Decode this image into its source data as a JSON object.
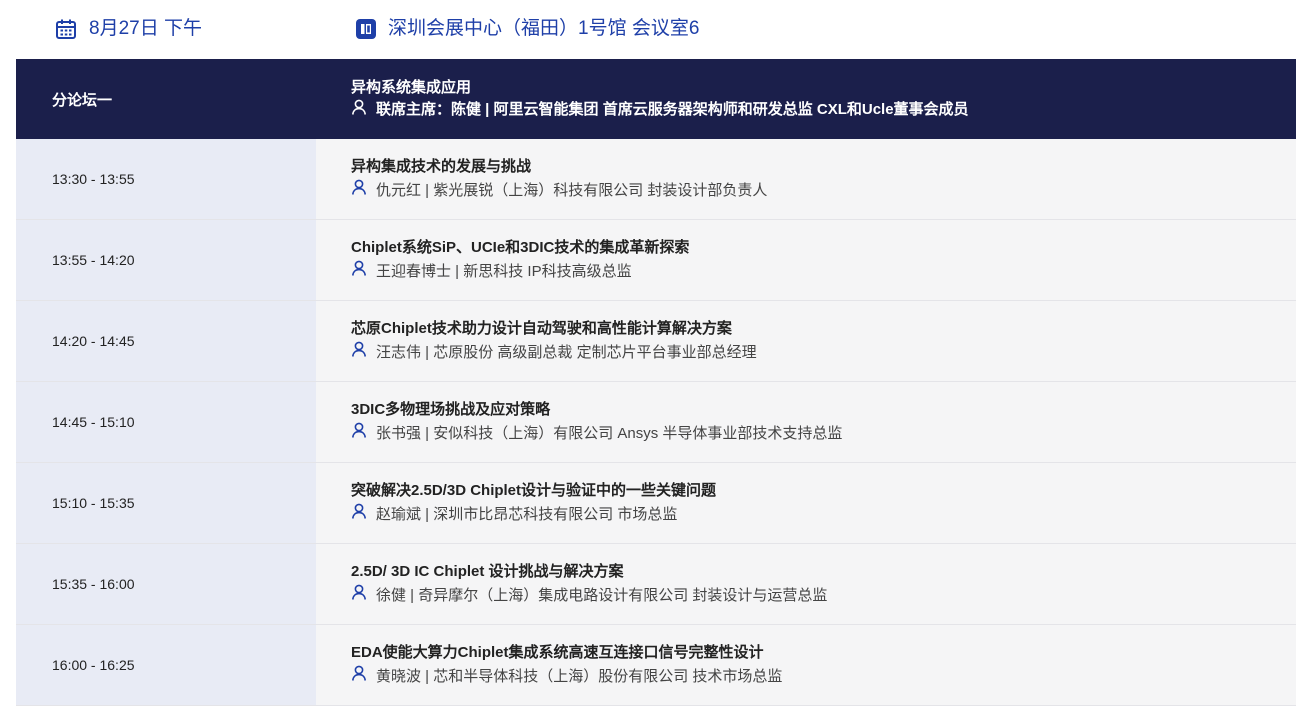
{
  "header": {
    "date": "8月27日 下午",
    "venue": "深圳会展中心（福田）1号馆 会议室6"
  },
  "session": {
    "name": "分论坛一",
    "title": "异构系统集成应用",
    "chair": "联席主席：陈健 | 阿里云智能集团 首席云服务器架构师和研发总监 CXL和Ucle董事会成员"
  },
  "colors": {
    "accent": "#1e3fa8",
    "header_bg": "#1b1f4b",
    "time_bg": "#e8ebf5",
    "row_bg": "#f5f5f6"
  },
  "agenda": [
    {
      "time": "13:30 - 13:55",
      "title": "异构集成技术的发展与挑战",
      "speaker": "仇元红 | 紫光展锐（上海）科技有限公司 封装设计部负责人"
    },
    {
      "time": "13:55 - 14:20",
      "title": "Chiplet系统SiP、UCIe和3DIC技术的集成革新探索",
      "speaker": "王迎春博士 | 新思科技 IP科技高级总监"
    },
    {
      "time": "14:20 - 14:45",
      "title": "芯原Chiplet技术助力设计自动驾驶和高性能计算解决方案",
      "speaker": "汪志伟 | 芯原股份 高级副总裁 定制芯片平台事业部总经理"
    },
    {
      "time": "14:45 - 15:10",
      "title": "3DIC多物理场挑战及应对策略",
      "speaker": "张书强 | 安似科技（上海）有限公司 Ansys 半导体事业部技术支持总监"
    },
    {
      "time": "15:10 - 15:35",
      "title": "突破解决2.5D/3D Chiplet设计与验证中的一些关键问题",
      "speaker": "赵瑜斌 | 深圳市比昂芯科技有限公司 市场总监"
    },
    {
      "time": "15:35 - 16:00",
      "title": "2.5D/ 3D IC Chiplet 设计挑战与解决方案",
      "speaker": "徐健 | 奇异摩尔（上海）集成电路设计有限公司 封装设计与运营总监"
    },
    {
      "time": "16:00 - 16:25",
      "title": "EDA使能大算力Chiplet集成系统高速互连接口信号完整性设计",
      "speaker": "黄晓波 | 芯和半导体科技（上海）股份有限公司 技术市场总监"
    }
  ]
}
